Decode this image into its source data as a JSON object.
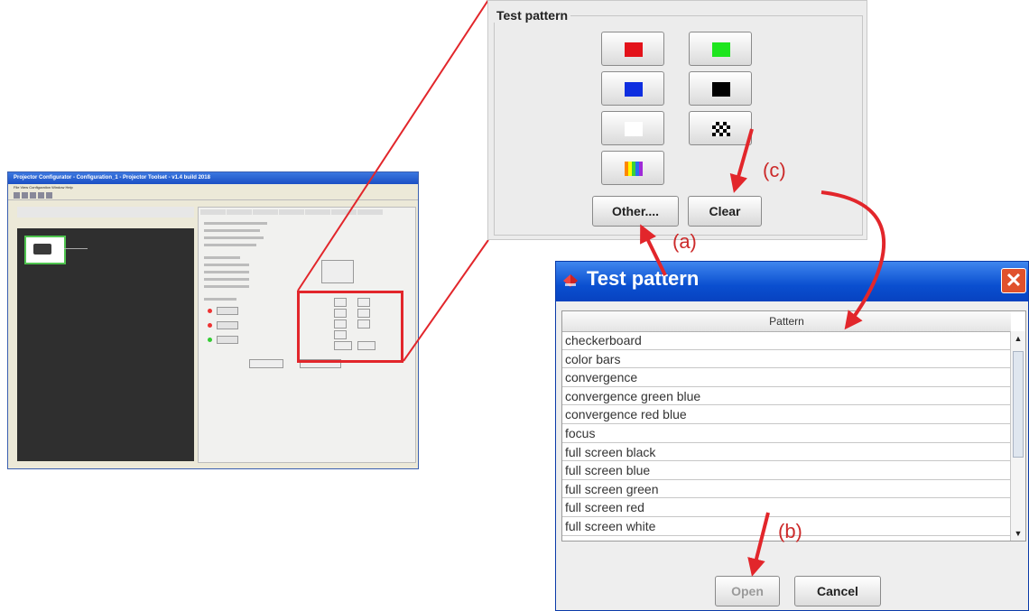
{
  "thumbnail": {
    "title": "Projector Configurator - Configuration_1 - Projector Toolset - v1.4 build 2018",
    "menu": "File  View  Configuration  Window  Help"
  },
  "panel": {
    "title": "Test pattern",
    "colors": {
      "red": "#e3121a",
      "green": "#1ee51e",
      "blue": "#0e2ee0",
      "black": "#000000",
      "white": "#ffffff"
    },
    "buttons": {
      "other_label": "Other....",
      "clear_label": "Clear"
    }
  },
  "dialog": {
    "title": "Test pattern",
    "close_glyph": "✕",
    "column_header": "Pattern",
    "rows": [
      "checkerboard",
      "color bars",
      "convergence",
      "convergence green blue",
      "convergence red blue",
      "focus",
      "full screen black",
      "full screen blue",
      "full screen green",
      "full screen red",
      "full screen white"
    ],
    "open_label": "Open",
    "cancel_label": "Cancel"
  },
  "annotations": {
    "a": "(a)",
    "b": "(b)",
    "c": "(c)",
    "color": "#cc2a2a"
  }
}
